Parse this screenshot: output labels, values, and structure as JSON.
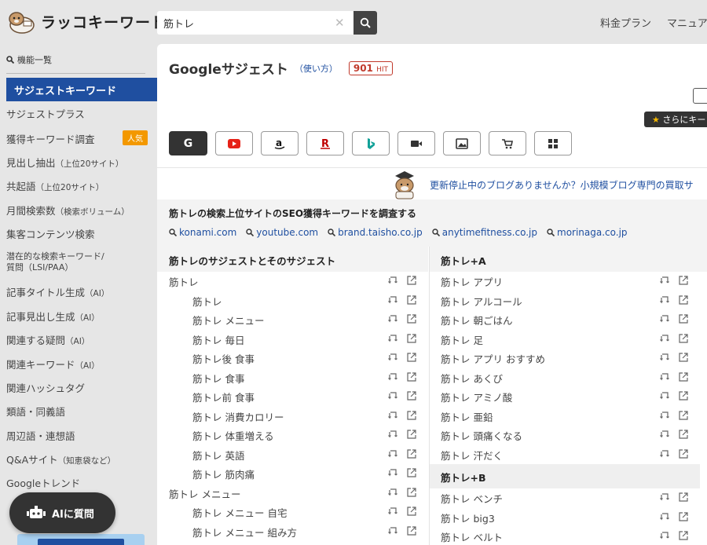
{
  "header": {
    "logo_text": "ラッコキーワード",
    "search_value": "筋トレ",
    "nav": [
      "料金プラン",
      "マニュアル"
    ]
  },
  "sidebar": {
    "heading": "機能一覧",
    "active": "サジェストキーワード",
    "items": [
      {
        "label": "サジェストプラス",
        "sub": ""
      },
      {
        "label": "獲得キーワード調査",
        "sub": "",
        "badge": "人気"
      },
      {
        "label": "見出し抽出",
        "sub": "（上位20サイト）"
      },
      {
        "label": "共起語",
        "sub": "（上位20サイト）"
      },
      {
        "label": "月間検索数",
        "sub": "（検索ボリューム）"
      },
      {
        "label": "集客コンテンツ検索",
        "sub": ""
      },
      {
        "label": "潜在的な検索キーワード/",
        "sub": "質問（LSI/PAA）"
      },
      {
        "label": "記事タイトル生成",
        "sub": "（AI）"
      },
      {
        "label": "記事見出し生成",
        "sub": "（AI）"
      },
      {
        "label": "関連する疑問",
        "sub": "（AI）"
      },
      {
        "label": "関連キーワード",
        "sub": "（AI）"
      },
      {
        "label": "関連ハッシュタグ",
        "sub": ""
      },
      {
        "label": "類語・同義語",
        "sub": ""
      },
      {
        "label": "周辺語・連想語",
        "sub": ""
      },
      {
        "label": "Q&Aサイト",
        "sub": "（知恵袋など）"
      },
      {
        "label": "Googleトレンド",
        "sub": ""
      }
    ],
    "ai_button": "AIに質問"
  },
  "main": {
    "title": "Googleサジェスト",
    "usage": "（使い方）",
    "hit_count": "901",
    "hit_label": "HIT",
    "more_button": "さらにキー",
    "engines": [
      "G",
      "youtube",
      "amazon",
      "R",
      "bing",
      "video",
      "image",
      "shopping",
      "apps"
    ],
    "promo_text": "更新停止中のブログありませんか？小規模ブログ専門の買取サ",
    "seo_title": "筋トレの検索上位サイトのSEO獲得キーワードを調査する",
    "seo_links": [
      "konami.com",
      "youtube.com",
      "brand.taisho.co.jp",
      "anytimefitness.co.jp",
      "morinaga.co.jp"
    ],
    "left_column": {
      "header": "筋トレのサジェストとそのサジェスト",
      "rows": [
        {
          "text": "筋トレ",
          "indent": false
        },
        {
          "text": "筋トレ",
          "indent": true
        },
        {
          "text": "筋トレ メニュー",
          "indent": true
        },
        {
          "text": "筋トレ 毎日",
          "indent": true
        },
        {
          "text": "筋トレ後 食事",
          "indent": true
        },
        {
          "text": "筋トレ 食事",
          "indent": true
        },
        {
          "text": "筋トレ前 食事",
          "indent": true
        },
        {
          "text": "筋トレ 消費カロリー",
          "indent": true
        },
        {
          "text": "筋トレ 体重増える",
          "indent": true
        },
        {
          "text": "筋トレ 英語",
          "indent": true
        },
        {
          "text": "筋トレ 筋肉痛",
          "indent": true
        },
        {
          "text": "筋トレ メニュー",
          "indent": false
        },
        {
          "text": "筋トレ メニュー 自宅",
          "indent": true
        },
        {
          "text": "筋トレ メニュー 組み方",
          "indent": true
        }
      ]
    },
    "right_column": {
      "header": "筋トレ+A",
      "rows_a": [
        "筋トレ アプリ",
        "筋トレ アルコール",
        "筋トレ 朝ごはん",
        "筋トレ 足",
        "筋トレ アプリ おすすめ",
        "筋トレ あくび",
        "筋トレ アミノ酸",
        "筋トレ 亜鉛",
        "筋トレ 頭痛くなる",
        "筋トレ 汗だく"
      ],
      "subheader": "筋トレ+B",
      "rows_b": [
        "筋トレ ベンチ",
        "筋トレ big3",
        "筋トレ ベルト"
      ]
    }
  },
  "colors": {
    "accent": "#1f4fa0",
    "badge": "#f39800",
    "hit": "#c0392b",
    "dark": "#333333"
  }
}
